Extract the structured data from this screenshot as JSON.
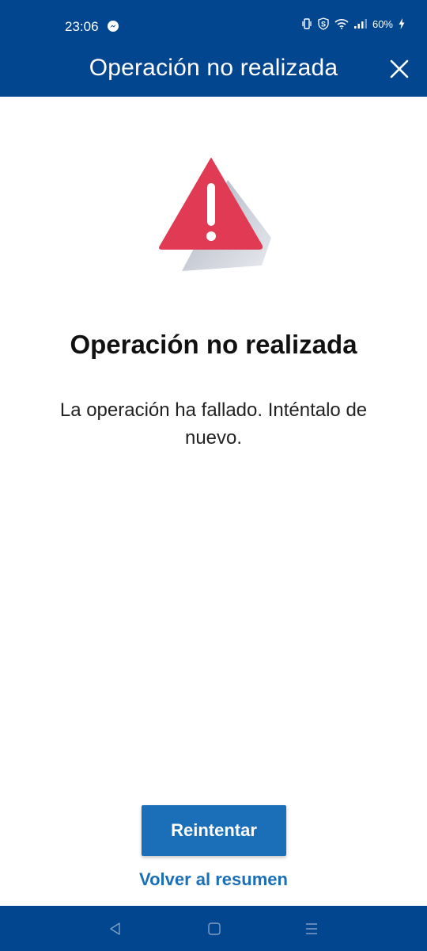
{
  "status_bar": {
    "time": "23:06",
    "battery": "60%",
    "icons": [
      "messenger-icon",
      "vibrate-icon",
      "shield-s-icon",
      "wifi-icon",
      "signal-icon",
      "charging-bolt-icon"
    ]
  },
  "header": {
    "title": "Operación no realizada",
    "close_icon": "close-icon"
  },
  "main": {
    "icon": "warning-triangle-icon",
    "title": "Operación no realizada",
    "message": "La operación ha fallado. Inténtalo de nuevo."
  },
  "actions": {
    "retry_label": "Reintentar",
    "back_label": "Volver al resumen"
  },
  "nav_bar": {
    "icons": [
      "nav-back-icon",
      "nav-home-icon",
      "nav-recents-icon"
    ]
  },
  "colors": {
    "brand_blue": "#02468f",
    "button_blue": "#1a6fb8",
    "alert_red": "#e03a55"
  }
}
